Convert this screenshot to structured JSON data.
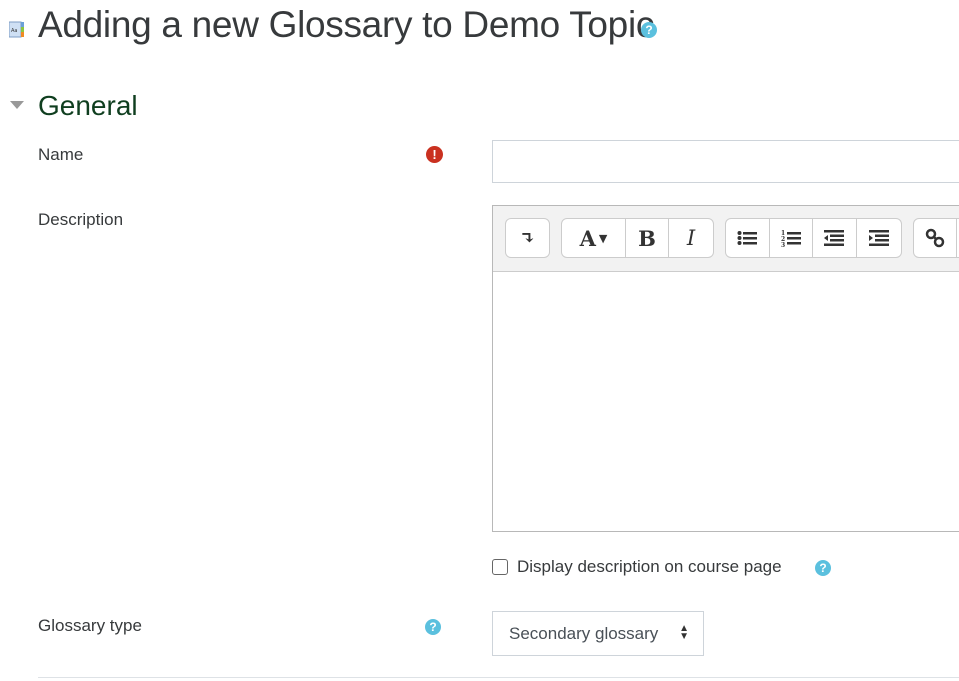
{
  "page": {
    "title": "Adding a new Glossary to Demo Topic",
    "title_icon": "glossary-module-icon",
    "help_icon": "question-circle-icon"
  },
  "section": {
    "title": "General",
    "toggle_icon": "caret-down-icon"
  },
  "fields": {
    "name": {
      "label": "Name",
      "value": "",
      "required_icon": "exclamation-circle-icon"
    },
    "description": {
      "label": "Description",
      "value": "",
      "toolbar": [
        {
          "name": "show-more",
          "glyph": "↴"
        },
        {
          "name": "font-style",
          "glyph": "A▾"
        },
        {
          "name": "bold",
          "glyph": "B"
        },
        {
          "name": "italic",
          "glyph": "I"
        },
        {
          "name": "unordered-list",
          "glyph": "•≡"
        },
        {
          "name": "ordered-list",
          "glyph": "1≡"
        },
        {
          "name": "outdent",
          "glyph": "⇤"
        },
        {
          "name": "indent",
          "glyph": "⇥"
        },
        {
          "name": "link",
          "glyph": "🔗"
        }
      ]
    },
    "display_description": {
      "label": "Display description on course page",
      "checked": false
    },
    "glossary_type": {
      "label": "Glossary type",
      "selected": "Secondary glossary"
    }
  },
  "colors": {
    "help": "#5bc0de",
    "required": "#ca3120",
    "section_title": "#0f3e1f"
  }
}
